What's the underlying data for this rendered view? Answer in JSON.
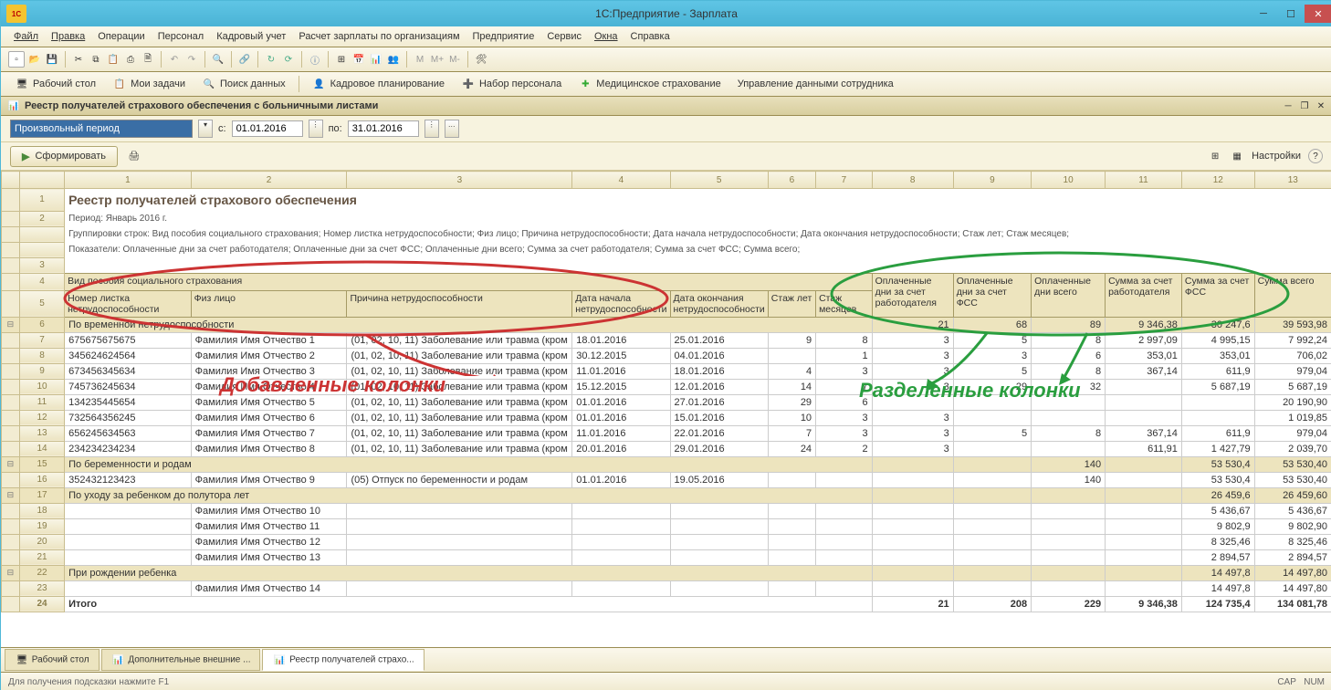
{
  "app": {
    "title": "1С:Предприятие - Зарплата"
  },
  "menu": [
    "Файл",
    "Правка",
    "Операции",
    "Персонал",
    "Кадровый учет",
    "Расчет зарплаты по организациям",
    "Предприятие",
    "Сервис",
    "Окна",
    "Справка"
  ],
  "nav": [
    {
      "l": "Рабочий стол"
    },
    {
      "l": "Мои задачи"
    },
    {
      "l": "Поиск данных"
    },
    {
      "l": "Кадровое планирование"
    },
    {
      "l": "Набор персонала"
    },
    {
      "l": "Медицинское страхование"
    },
    {
      "l": "Управление данными сотрудника"
    }
  ],
  "doc": {
    "title": "Реестр получателей страхового обеспечения с больничными листами"
  },
  "filter": {
    "period": "Произвольный период",
    "from_l": "с:",
    "from": "01.01.2016",
    "to_l": "по:",
    "to": "31.01.2016"
  },
  "actions": {
    "form": "Сформировать",
    "settings": "Настройки"
  },
  "report": {
    "title": "Реестр получателей страхового обеспечения",
    "period": "Период: Январь 2016 г.",
    "group": "Группировки строк: Вид пособия социального страхования; Номер листка нетрудоспособности; Физ лицо; Причина нетрудоспособности; Дата начала нетрудоспособности; Дата окончания нетрудоспособности; Стаж лет; Стаж месяцев;",
    "ind": "Показатели: Оплаченные дни за счет работодателя; Оплаченные дни за счет ФСС; Оплаченные дни всего; Сумма за счет работодателя; Сумма за счет ФСС; Сумма всего;"
  },
  "headers": {
    "top": "Вид пособия социального страхования",
    "c1": "Номер листка нетрудоспособности",
    "c2": "Физ лицо",
    "c3": "Причина нетрудоспособности",
    "c4": "Дата начала нетрудоспособности",
    "c5": "Дата окончания нетрудоспособности",
    "c6": "Стаж лет",
    "c7": "Стаж месяцев",
    "c8": "Оплаченные дни за счет работодателя",
    "c9": "Оплаченные дни за счет ФСС",
    "c10": "Оплаченные дни всего",
    "c11": "Сумма за счет работодателя",
    "c12": "Сумма за счет ФСС",
    "c13": "Сумма всего"
  },
  "groups": [
    {
      "n": "6",
      "t": "По временной нетрудоспособности",
      "v": [
        "21",
        "68",
        "89",
        "9 346,38",
        "30 247,6",
        "39 593,98"
      ],
      "rows": [
        {
          "n": "7",
          "c": [
            "675675675675",
            "Фамилия Имя Отчество 1",
            "(01, 02, 10, 11) Заболевание или травма (кром",
            "18.01.2016",
            "25.01.2016",
            "9",
            "8",
            "3",
            "5",
            "8",
            "2 997,09",
            "4 995,15",
            "7 992,24"
          ]
        },
        {
          "n": "8",
          "c": [
            "345624624564",
            "Фамилия Имя Отчество 2",
            "(01, 02, 10, 11) Заболевание или травма (кром",
            "30.12.2015",
            "04.01.2016",
            "",
            "1",
            "3",
            "3",
            "6",
            "353,01",
            "353,01",
            "706,02"
          ]
        },
        {
          "n": "9",
          "c": [
            "673456345634",
            "Фамилия Имя Отчество 3",
            "(01, 02, 10, 11) Заболевание или травма (кром",
            "11.01.2016",
            "18.01.2016",
            "4",
            "3",
            "3",
            "5",
            "8",
            "367,14",
            "611,9",
            "979,04"
          ]
        },
        {
          "n": "10",
          "c": [
            "745736245634",
            "Фамилия Имя Отчество 4",
            "(01, 02, 10, 11) Заболевание или травма (кром",
            "15.12.2015",
            "12.01.2016",
            "14",
            "7",
            "3",
            "29",
            "32",
            "",
            "5 687,19",
            "5 687,19"
          ]
        },
        {
          "n": "11",
          "c": [
            "134235445654",
            "Фамилия Имя Отчество 5",
            "(01, 02, 10, 11) Заболевание или травма (кром",
            "01.01.2016",
            "27.01.2016",
            "29",
            "6",
            "",
            "",
            "",
            "",
            "",
            "20 190,90"
          ]
        },
        {
          "n": "12",
          "c": [
            "732564356245",
            "Фамилия Имя Отчество 6",
            "(01, 02, 10, 11) Заболевание или травма (кром",
            "01.01.2016",
            "15.01.2016",
            "10",
            "3",
            "3",
            "",
            "",
            "",
            "",
            "1 019,85"
          ]
        },
        {
          "n": "13",
          "c": [
            "656245634563",
            "Фамилия Имя Отчество 7",
            "(01, 02, 10, 11) Заболевание или травма (кром",
            "11.01.2016",
            "22.01.2016",
            "7",
            "3",
            "3",
            "5",
            "8",
            "367,14",
            "611,9",
            "979,04"
          ]
        },
        {
          "n": "14",
          "c": [
            "234234234234",
            "Фамилия Имя Отчество 8",
            "(01, 02, 10, 11) Заболевание или травма (кром",
            "20.01.2016",
            "29.01.2016",
            "24",
            "2",
            "3",
            "",
            "",
            "611,91",
            "1 427,79",
            "2 039,70"
          ]
        }
      ]
    },
    {
      "n": "15",
      "t": "По беременности и родам",
      "v": [
        "",
        "",
        "140",
        "",
        "53 530,4",
        "53 530,40"
      ],
      "rows": [
        {
          "n": "16",
          "c": [
            "352432123423",
            "Фамилия Имя Отчество 9",
            "(05) Отпуск по беременности и родам",
            "01.01.2016",
            "19.05.2016",
            "",
            "",
            "",
            "",
            "140",
            "",
            "53 530,4",
            "53 530,40"
          ]
        }
      ]
    },
    {
      "n": "17",
      "t": "По уходу за ребенком до полутора лет",
      "v": [
        "",
        "",
        "",
        "",
        "26 459,6",
        "26 459,60"
      ],
      "rows": [
        {
          "n": "18",
          "c": [
            "",
            "Фамилия Имя Отчество 10",
            "",
            "",
            "",
            "",
            "",
            "",
            "",
            "",
            "",
            "5 436,67",
            "5 436,67"
          ]
        },
        {
          "n": "19",
          "c": [
            "",
            "Фамилия Имя Отчество 11",
            "",
            "",
            "",
            "",
            "",
            "",
            "",
            "",
            "",
            "9 802,9",
            "9 802,90"
          ]
        },
        {
          "n": "20",
          "c": [
            "",
            "Фамилия Имя Отчество 12",
            "",
            "",
            "",
            "",
            "",
            "",
            "",
            "",
            "",
            "8 325,46",
            "8 325,46"
          ]
        },
        {
          "n": "21",
          "c": [
            "",
            "Фамилия Имя Отчество 13",
            "",
            "",
            "",
            "",
            "",
            "",
            "",
            "",
            "",
            "2 894,57",
            "2 894,57"
          ]
        }
      ]
    },
    {
      "n": "22",
      "t": "При рождении ребенка",
      "v": [
        "",
        "",
        "",
        "",
        "14 497,8",
        "14 497,80"
      ],
      "rows": [
        {
          "n": "23",
          "c": [
            "",
            "Фамилия Имя Отчество 14",
            "",
            "",
            "",
            "",
            "",
            "",
            "",
            "",
            "",
            "14 497,8",
            "14 497,80"
          ]
        }
      ]
    }
  ],
  "total": {
    "n": "24",
    "l": "Итого",
    "v": [
      "21",
      "208",
      "229",
      "9 346,38",
      "124 735,4",
      "134 081,78"
    ]
  },
  "ann": {
    "red": "Добавленные колонки",
    "green": "Разделенные колонки"
  },
  "ruler": [
    "",
    "1",
    "2",
    "3",
    "4",
    "5",
    "6",
    "7",
    "8",
    "9",
    "10",
    "11",
    "12",
    "13"
  ],
  "tabs": [
    "Рабочий стол",
    "Дополнительные внешние ...",
    "Реестр получателей страхо..."
  ],
  "status": {
    "hint": "Для получения подсказки нажмите F1",
    "cap": "CAP",
    "num": "NUM"
  }
}
